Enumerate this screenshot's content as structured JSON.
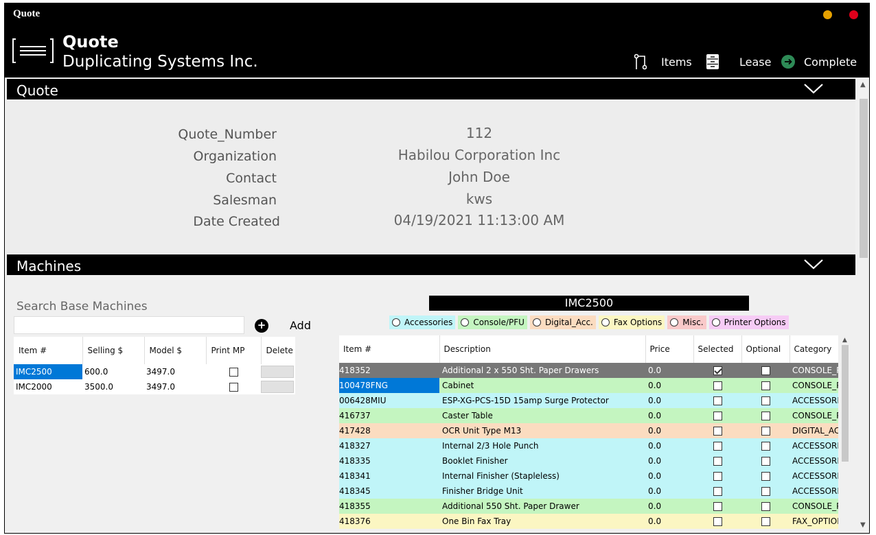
{
  "window": {
    "title": "Quote"
  },
  "header": {
    "title": "Quote",
    "company": "Duplicating Systems Inc.",
    "nav": [
      {
        "label": "Items",
        "icon": "branch-icon"
      },
      {
        "label": "Lease",
        "icon": "cabinet-icon"
      },
      {
        "label": "Complete",
        "icon": "arrow-right-circle-icon"
      }
    ]
  },
  "quote_section": {
    "label": "Quote",
    "fields": [
      {
        "key": "Quote_Number",
        "value": "112"
      },
      {
        "key": "Organization",
        "value": "Habilou Corporation Inc"
      },
      {
        "key": "Contact",
        "value": "John Doe"
      },
      {
        "key": "Salesman",
        "value": "kws"
      },
      {
        "key": "Date Created",
        "value": "04/19/2021 11:13:00 AM"
      }
    ]
  },
  "machines_section": {
    "label": "Machines",
    "search_label": "Search Base Machines",
    "search_value": "",
    "add_label": "Add",
    "base_columns": [
      "Item #",
      "Selling $",
      "Model $",
      "Print MP",
      "Delete"
    ],
    "base_rows": [
      {
        "item": "IMC2500",
        "selling": "600.0",
        "model": "3497.0",
        "print_mp": false
      },
      {
        "item": "IMC2000",
        "selling": "3500.0",
        "model": "3497.0",
        "print_mp": false
      }
    ],
    "selected_machine": "IMC2500",
    "filters": [
      {
        "label": "Accessories",
        "color": "#c0f5f8"
      },
      {
        "label": "Console/PFU",
        "color": "#c4f5c0"
      },
      {
        "label": "Digital_Acc.",
        "color": "#fbdcc0"
      },
      {
        "label": "Fax Options",
        "color": "#fbf6c2"
      },
      {
        "label": "Misc.",
        "color": "#f9c9c9"
      },
      {
        "label": "Printer Options",
        "color": "#f6cbf5"
      }
    ],
    "item_columns": [
      "Item #",
      "Description",
      "Price",
      "Selected",
      "Optional",
      "Category"
    ],
    "items": [
      {
        "item": "418352",
        "desc": "Additional 2 x 550 Sht. Paper Drawers",
        "price": "0.0",
        "selected": true,
        "optional": false,
        "category": "CONSOLE_PFU",
        "color": "#777777"
      },
      {
        "item": "100478FNG",
        "desc": "Cabinet",
        "price": "0.0",
        "selected": false,
        "optional": false,
        "category": "CONSOLE_PFU",
        "color": "#c4f5c0"
      },
      {
        "item": "006428MIU",
        "desc": "ESP-XG-PCS-15D 15amp Surge Protector",
        "price": "0.0",
        "selected": false,
        "optional": false,
        "category": "ACCESSORIES",
        "color": "#c0f5f8"
      },
      {
        "item": "416737",
        "desc": "Caster Table",
        "price": "0.0",
        "selected": false,
        "optional": false,
        "category": "CONSOLE_PFU",
        "color": "#c4f5c0"
      },
      {
        "item": "417428",
        "desc": "OCR Unit Type M13",
        "price": "0.0",
        "selected": false,
        "optional": false,
        "category": "DIGITAL_ACC",
        "color": "#fbdcc0"
      },
      {
        "item": "418327",
        "desc": "Internal 2/3 Hole Punch",
        "price": "0.0",
        "selected": false,
        "optional": false,
        "category": "ACCESSORIES",
        "color": "#c0f5f8"
      },
      {
        "item": "418335",
        "desc": "Booklet Finisher",
        "price": "0.0",
        "selected": false,
        "optional": false,
        "category": "ACCESSORIES",
        "color": "#c0f5f8"
      },
      {
        "item": "418341",
        "desc": "Internal Finisher (Stapleless)",
        "price": "0.0",
        "selected": false,
        "optional": false,
        "category": "ACCESSORIES",
        "color": "#c0f5f8"
      },
      {
        "item": "418345",
        "desc": "Finisher Bridge Unit",
        "price": "0.0",
        "selected": false,
        "optional": false,
        "category": "ACCESSORIES",
        "color": "#c0f5f8"
      },
      {
        "item": "418355",
        "desc": "Additional 550 Sht. Paper Drawer",
        "price": "0.0",
        "selected": false,
        "optional": false,
        "category": "CONSOLE_PFU",
        "color": "#c4f5c0"
      },
      {
        "item": "418376",
        "desc": "One Bin Fax Tray",
        "price": "0.0",
        "selected": false,
        "optional": false,
        "category": "FAX_OPTIONS",
        "color": "#fbf6c2"
      }
    ]
  }
}
